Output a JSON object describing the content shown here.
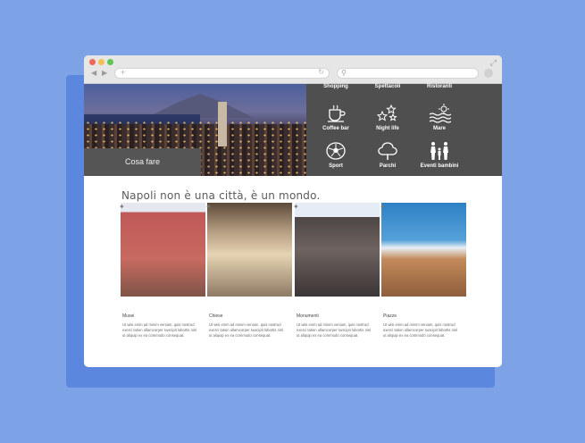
{
  "hero": {
    "caption": "Cosa fare"
  },
  "menu": {
    "top": [
      "Shopping",
      "Spettacoli",
      "Ristoranti"
    ],
    "items": [
      {
        "label": "Coffee bar",
        "icon": "coffee-cup-icon"
      },
      {
        "label": "Night life",
        "icon": "stars-icon"
      },
      {
        "label": "Mare",
        "icon": "waves-sun-icon"
      },
      {
        "label": "Sport",
        "icon": "soccer-ball-icon"
      },
      {
        "label": "Parchi",
        "icon": "tree-icon"
      },
      {
        "label": "Eventi bambini",
        "icon": "family-icon"
      }
    ]
  },
  "main": {
    "title": "Napoli non è una città, è un mondo.",
    "cards": [
      {
        "title": "Musei",
        "text": "Ut wisi enim ad minim veniam, quis nostrud exerci tation ullamcorper suscipit lobortis nisl ut aliquip ex ea commodo consequat."
      },
      {
        "title": "Chiese",
        "text": "Ut wisi enim ad minim veniam, quis nostrud exerci tation ullamcorper suscipit lobortis nisl ut aliquip ex ea commodo consequat."
      },
      {
        "title": "Monumenti",
        "text": "Ut wisi enim ad minim veniam, quis nostrud exerci tation ullamcorper suscipit lobortis nisl ut aliquip ex ea commodo consequat."
      },
      {
        "title": "Piazze",
        "text": "Ut wisi enim ad minim veniam, quis nostrud exerci tation ullamcorper suscipit lobortis nisl ut aliquip ex ea commodo consequat."
      }
    ]
  }
}
